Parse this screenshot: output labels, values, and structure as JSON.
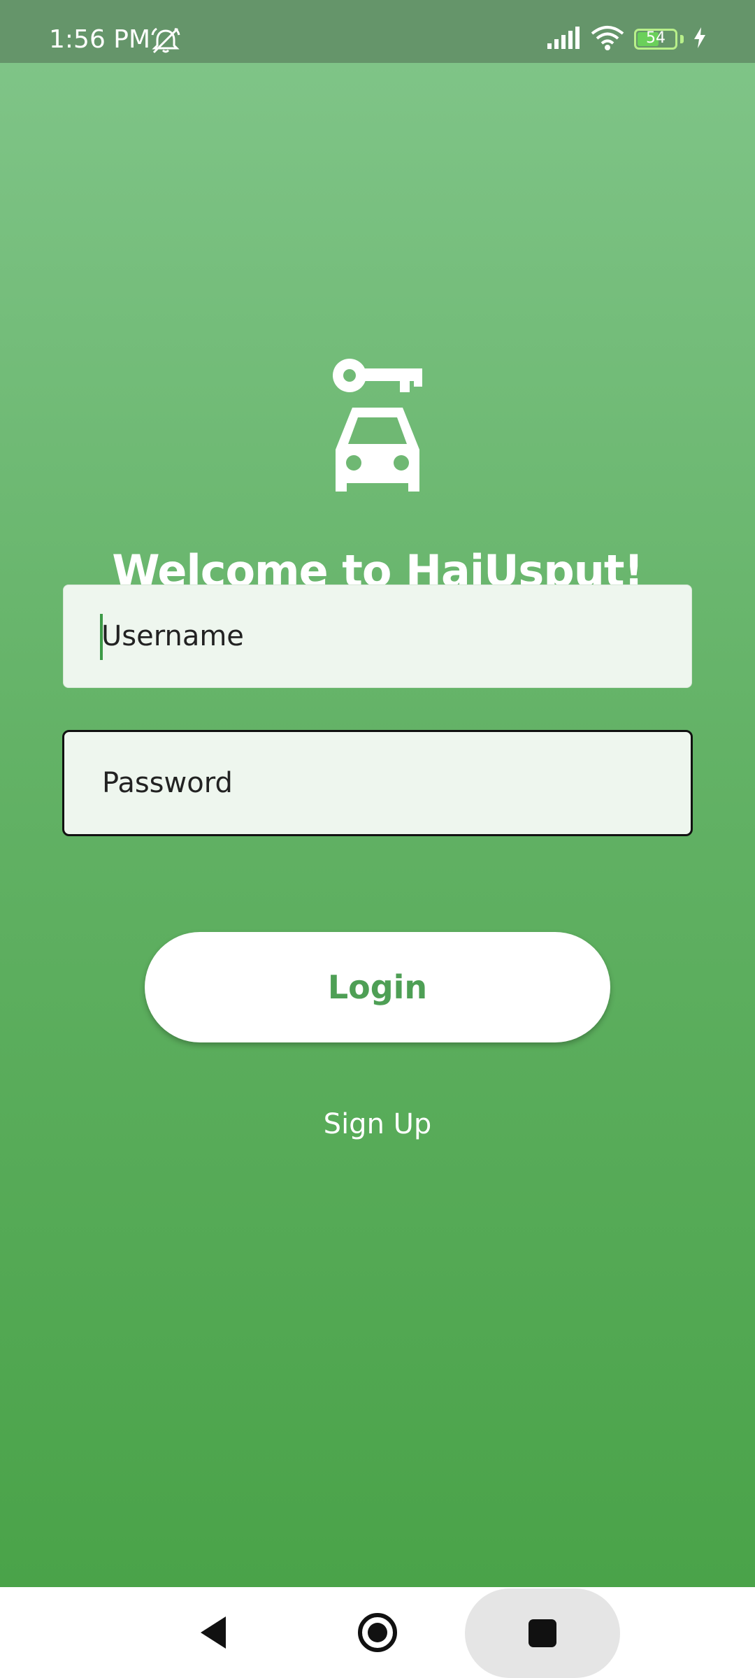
{
  "status_bar": {
    "time": "1:56 PM",
    "left_icons": [
      "alarm-off-icon"
    ],
    "right_icons": [
      "signal-icon",
      "wifi-icon",
      "battery-icon",
      "charging-icon"
    ],
    "battery_level": "54",
    "background_color": "#65956a"
  },
  "app": {
    "logo_icon": "car-key-icon",
    "welcome_text": "Welcome to HajUsput!",
    "background_color_top": "#7fc487",
    "background_color_bottom": "#4aa349"
  },
  "form": {
    "username": {
      "value": "",
      "placeholder": "Username"
    },
    "password": {
      "value": "",
      "placeholder": "Password"
    },
    "login_label": "Login",
    "signup_label": "Sign Up",
    "accent_color": "#4e9f55"
  },
  "nav_bar": {
    "buttons": [
      "back-icon",
      "home-icon",
      "recents-icon"
    ]
  }
}
